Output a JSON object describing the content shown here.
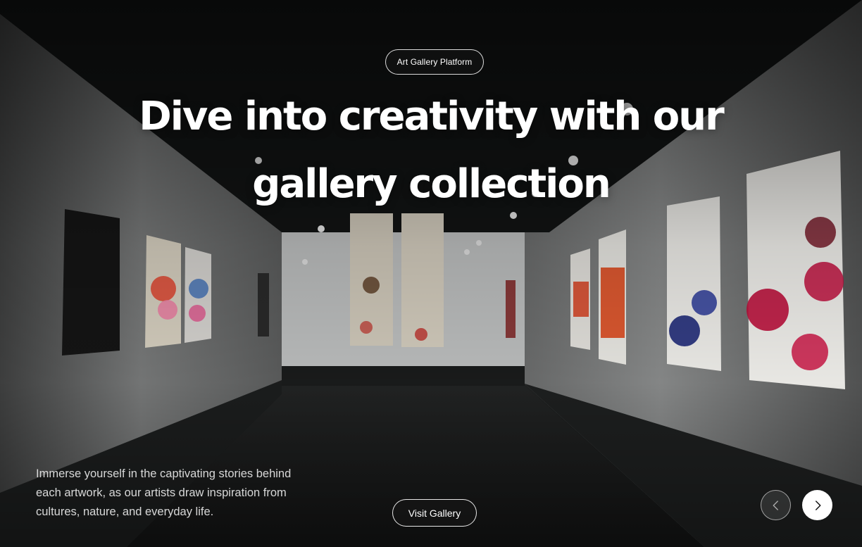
{
  "hero": {
    "badge_label": "Art Gallery Platform",
    "headline_line1": "Dive into creativity with our",
    "headline_line2": "gallery collection",
    "description": "Immerse yourself in the captivating stories behind each artwork, as our artists draw inspiration from cultures, nature, and everyday life.",
    "cta_label": "Visit Gallery"
  },
  "carousel": {
    "prev_icon": "chevron-left-icon",
    "next_icon": "chevron-right-icon"
  },
  "colors": {
    "text_primary": "#ffffff",
    "background_dark": "#0b0d0d",
    "button_light": "#ffffff"
  }
}
